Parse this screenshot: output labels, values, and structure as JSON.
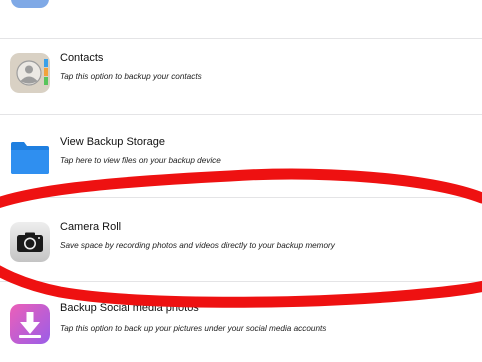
{
  "menu": {
    "items": [
      {
        "title": "Contacts",
        "subtitle": "Tap this option to backup your contacts",
        "icon": "contacts-icon"
      },
      {
        "title": "View Backup Storage",
        "subtitle": "Tap here to view files on your backup device",
        "icon": "folder-icon"
      },
      {
        "title": "Camera Roll",
        "subtitle": "Save space by recording photos and videos directly to your backup memory",
        "icon": "camera-icon"
      },
      {
        "title": "Backup Social media photos",
        "subtitle": "Tap this option to back up your pictures under your social media accounts",
        "icon": "download-icon"
      }
    ]
  },
  "colors": {
    "highlight": "#ee1111",
    "divider": "#e4e4e6",
    "folder": "#1f7fe0",
    "social": "#b55fe0"
  }
}
